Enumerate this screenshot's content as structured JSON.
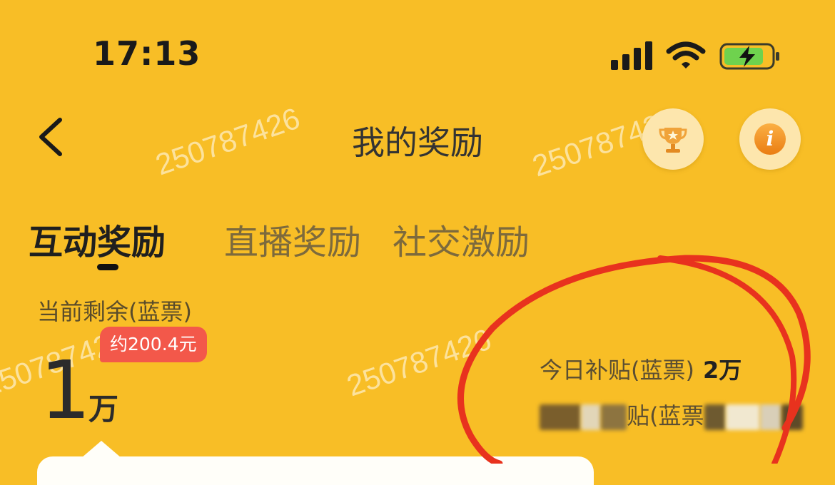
{
  "status_bar": {
    "time": "17:13"
  },
  "nav": {
    "title": "我的奖励"
  },
  "tabs": [
    {
      "label": "互动奖励",
      "active": true
    },
    {
      "label": "直播奖励",
      "active": false
    },
    {
      "label": "社交激励",
      "active": false
    }
  ],
  "balance": {
    "label": "当前剩余(蓝票)",
    "approx_badge": "约200.4元",
    "value": "1",
    "unit": "万"
  },
  "subsidy": {
    "today_label": "今日补贴(蓝票)",
    "today_value": "2万",
    "total_label_visible": "贴(蓝票"
  },
  "watermark": "250787426",
  "colors": {
    "background": "#f8be26",
    "badge": "#f3584a",
    "annotation": "#e8321e"
  }
}
